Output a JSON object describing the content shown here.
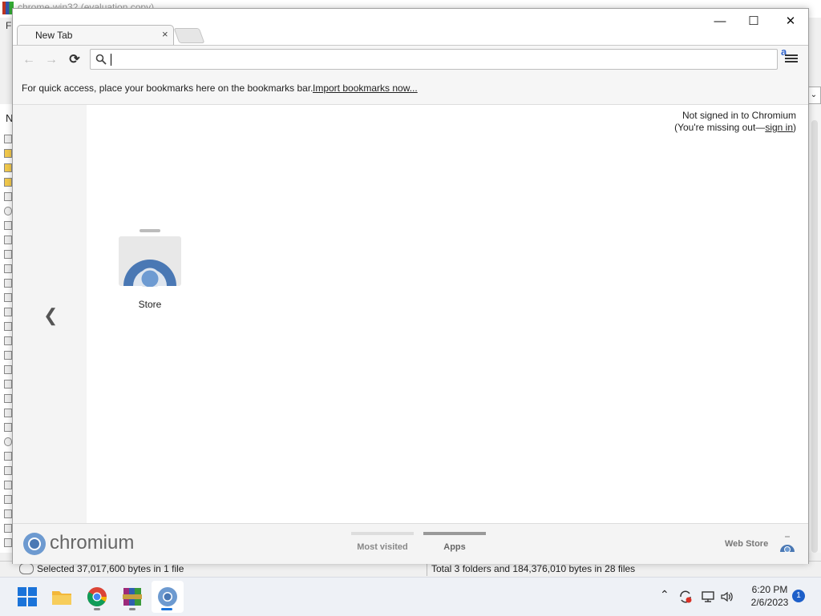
{
  "background_app": {
    "title": "chrome-win32 (evaluation copy)",
    "menu_letter": "Fi",
    "column_letter": "N",
    "status_left": "Selected 37,017,600 bytes in 1 file",
    "status_right": "Total 3 folders and 184,376,010 bytes in 28 files"
  },
  "browser": {
    "tab_title": "New Tab",
    "tab_close_glyph": "×",
    "window_controls": {
      "minimize": "—",
      "maximize": "☐",
      "close": "✕"
    },
    "nav": {
      "back": "←",
      "forward": "→",
      "reload": "⟳"
    },
    "omnibox_value": "",
    "extension_glyph": "a",
    "bookmarks_bar": {
      "hint": "For quick access, place your bookmarks here on the bookmarks bar.",
      "import_link": "Import bookmarks now..."
    },
    "signin": {
      "line1": "Not signed in to Chromium",
      "prefix": "(You're missing out—",
      "link": "sign in",
      "suffix": ")"
    },
    "prev_arrow": "❮",
    "apps": [
      {
        "label": "Store",
        "icon": "web-store-icon"
      }
    ],
    "footer": {
      "logo_text": "chromium",
      "tabs": [
        {
          "label": "Most visited",
          "active": false
        },
        {
          "label": "Apps",
          "active": true
        }
      ],
      "webstore_label": "Web Store"
    }
  },
  "taskbar": {
    "pinned": [
      "windows-start-icon",
      "file-explorer-icon",
      "chrome-icon",
      "winrar-icon",
      "chromium-icon"
    ],
    "tray_chevron": "^",
    "clock_time": "6:20 PM",
    "clock_date": "2/6/2023",
    "notification_count": "1",
    "colors": {
      "accent": "#1d5fc9"
    }
  }
}
